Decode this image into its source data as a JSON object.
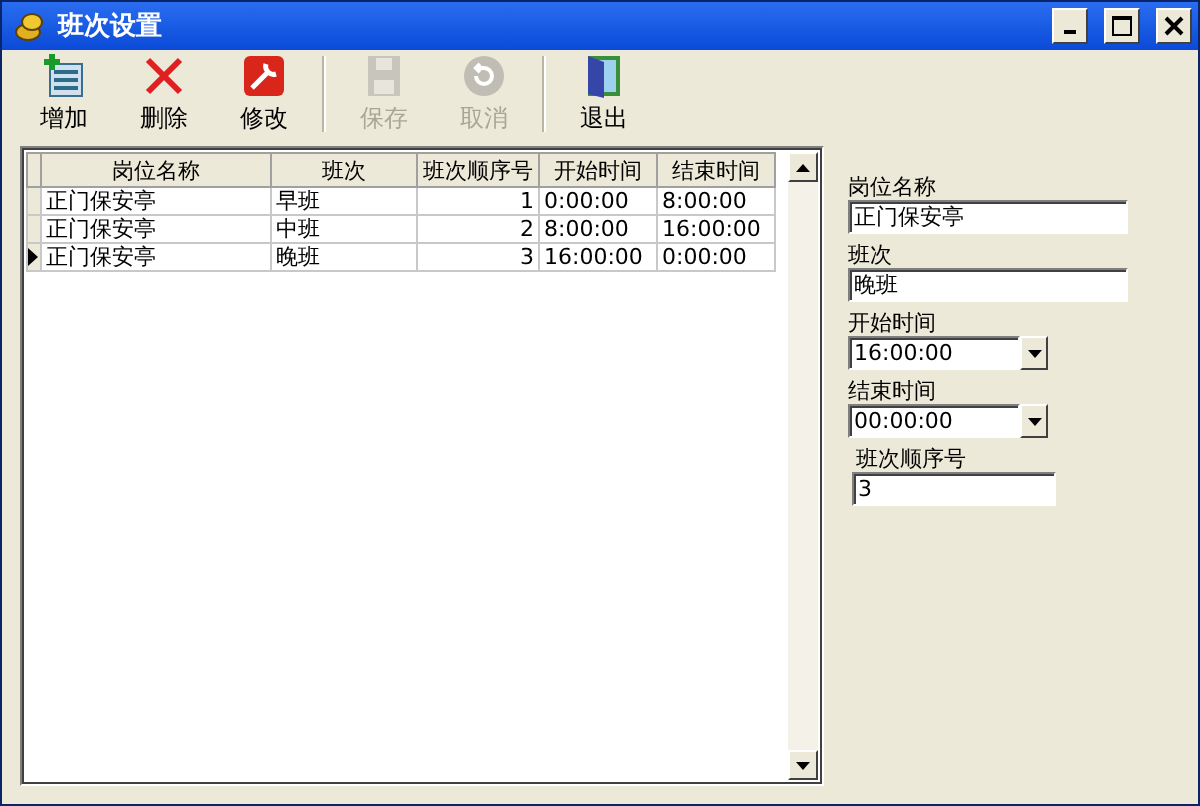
{
  "window": {
    "title": "班次设置"
  },
  "toolbar": [
    {
      "label": "增加",
      "kind": "add",
      "disabled": false
    },
    {
      "label": "删除",
      "kind": "delete",
      "disabled": false
    },
    {
      "label": "修改",
      "kind": "edit",
      "disabled": false
    },
    {
      "kind": "separator"
    },
    {
      "label": "保存",
      "kind": "save",
      "disabled": true
    },
    {
      "label": "取消",
      "kind": "cancel",
      "disabled": true
    },
    {
      "kind": "separator"
    },
    {
      "label": "退出",
      "kind": "exit",
      "disabled": false
    }
  ],
  "table": {
    "columns": [
      "岗位名称",
      "班次",
      "班次顺序号",
      "开始时间",
      "结束时间"
    ],
    "rows": [
      {
        "cells": [
          "正门保安亭",
          "早班",
          "1",
          "0:00:00",
          "8:00:00"
        ],
        "selected": false
      },
      {
        "cells": [
          "正门保安亭",
          "中班",
          "2",
          "8:00:00",
          "16:00:00"
        ],
        "selected": false
      },
      {
        "cells": [
          "正门保安亭",
          "晚班",
          "3",
          "16:00:00",
          "0:00:00"
        ],
        "selected": true
      }
    ]
  },
  "form": [
    {
      "label": "岗位名称",
      "value": "正门保安亭",
      "kind": "text"
    },
    {
      "label": "班次",
      "value": "晚班",
      "kind": "text"
    },
    {
      "label": "开始时间",
      "value": "16:00:00",
      "kind": "dropdown"
    },
    {
      "label": "结束时间",
      "value": "00:00:00",
      "kind": "dropdown"
    },
    {
      "label": "班次顺序号",
      "value": "3",
      "kind": "short"
    }
  ]
}
